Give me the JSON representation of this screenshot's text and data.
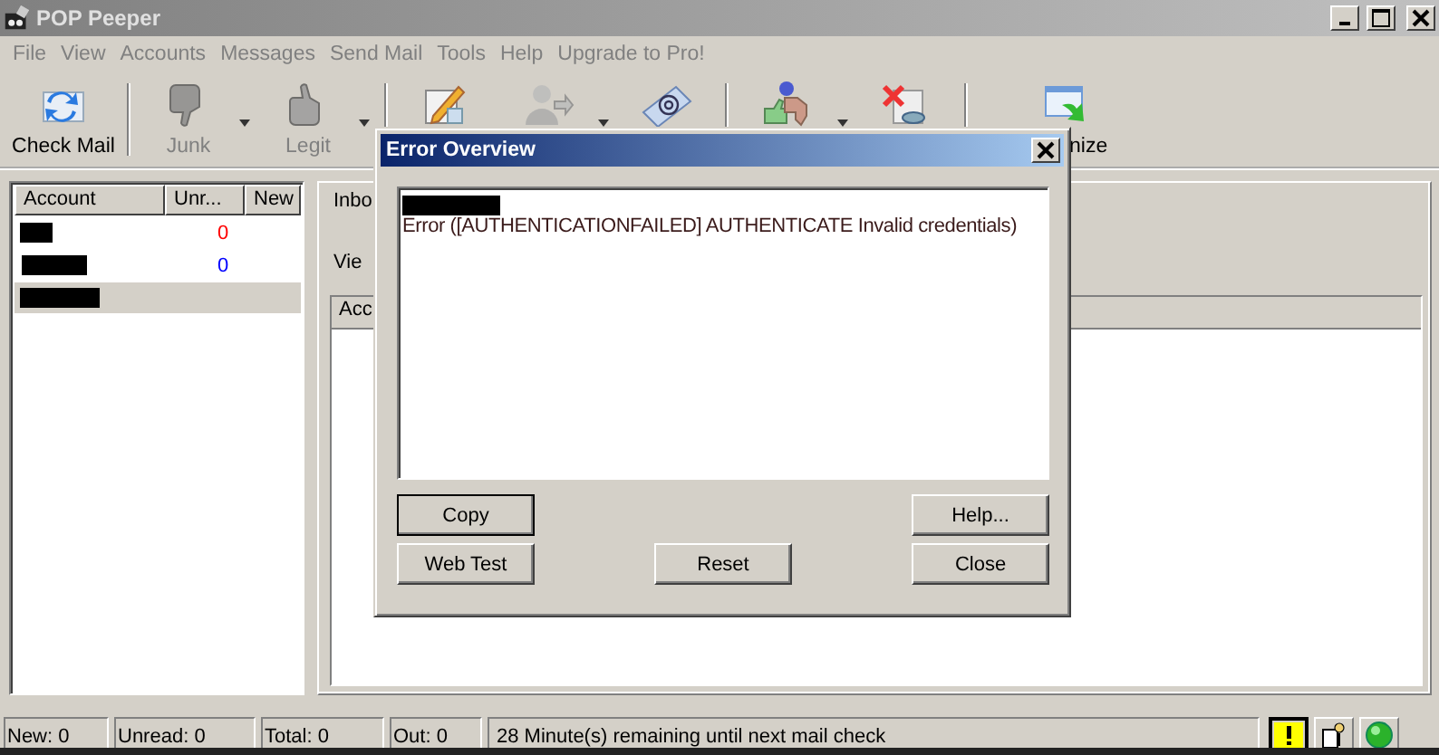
{
  "window": {
    "title": "POP Peeper"
  },
  "menu": [
    {
      "label": "File"
    },
    {
      "label": "View"
    },
    {
      "label": "Accounts"
    },
    {
      "label": "Messages"
    },
    {
      "label": "Send Mail"
    },
    {
      "label": "Tools"
    },
    {
      "label": "Help"
    },
    {
      "label": "Upgrade to Pro!"
    }
  ],
  "toolbar": [
    {
      "kind": "refresh",
      "label": "Check Mail",
      "disabled": false,
      "dropdown": false
    },
    {
      "kind": "thumbdown",
      "label": "Junk",
      "disabled": true,
      "dropdown": true
    },
    {
      "kind": "thumbup",
      "label": "Legit",
      "disabled": true,
      "dropdown": true
    },
    {
      "kind": "compose",
      "disabled": false,
      "dropdown": false
    },
    {
      "kind": "person",
      "disabled": true,
      "dropdown": true
    },
    {
      "kind": "at",
      "disabled": false,
      "dropdown": false
    },
    {
      "kind": "question",
      "disabled": false,
      "dropdown": true
    },
    {
      "kind": "delete",
      "disabled": false,
      "dropdown": false
    },
    {
      "kind": "window",
      "label": "nize",
      "disabled": false,
      "dropdown": false
    }
  ],
  "accounts": {
    "columns": [
      "Account",
      "Unr...",
      "New"
    ],
    "rows": [
      {
        "unread": "0",
        "color": "#ff0000",
        "selected": false
      },
      {
        "unread": "0",
        "color": "#0000ff",
        "selected": false
      },
      {
        "selected": true
      }
    ]
  },
  "mail_pane": {
    "tab": "Inbo",
    "view_label": "Vie",
    "column_1": "Acc"
  },
  "dialog": {
    "title": "Error Overview",
    "message": "Error ([AUTHENTICATIONFAILED] AUTHENTICATE Invalid credentials)",
    "buttons": [
      {
        "label": "Copy",
        "focused": true
      },
      {
        "label": "Help...",
        "focused": false
      },
      {
        "label": "Web Test",
        "focused": false
      },
      {
        "label": "Reset",
        "focused": false
      },
      {
        "label": "Close",
        "focused": false
      }
    ]
  },
  "status_bar": [
    {
      "text": "New: 0"
    },
    {
      "text": "Unread: 0"
    },
    {
      "text": "Total: 0"
    },
    {
      "text": "Out: 0"
    },
    {
      "text": "28 Minute(s) remaining until next mail check"
    }
  ]
}
